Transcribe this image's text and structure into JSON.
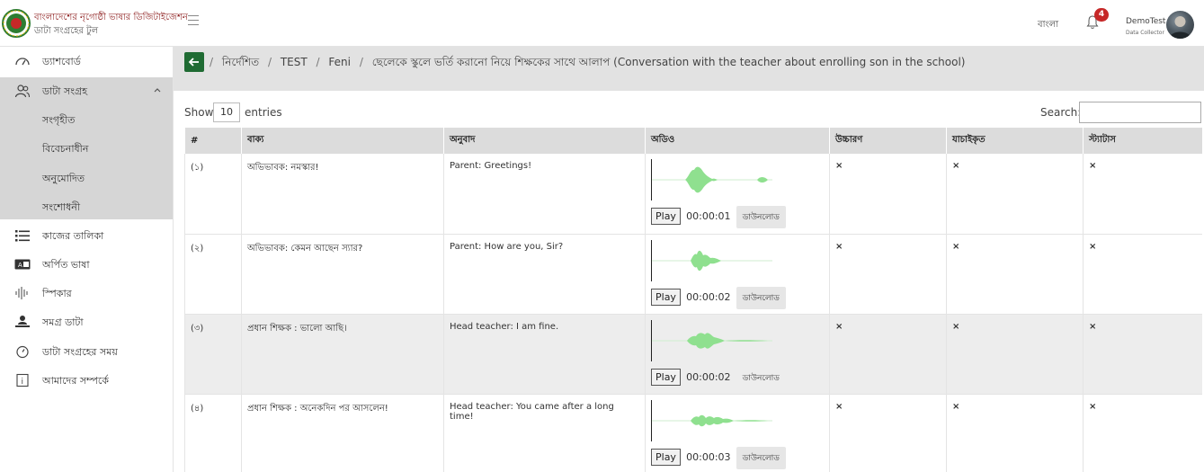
{
  "brand": {
    "title": "বাংলাদেশের নৃগোষ্ঠী ভাষার ডিজিটাইজেশন",
    "subtitle": "ডাটা সংগ্রহের টুল"
  },
  "header": {
    "language": "বাংলা",
    "notification_count": "4",
    "user_name": "DemoTest",
    "user_role": "Data Collector"
  },
  "sidebar": {
    "items": [
      {
        "label": "ড্যাশবোর্ড",
        "icon": "dashboard-gauge-icon"
      },
      {
        "label": "ডাটা সংগ্রহ",
        "icon": "users-group-icon"
      },
      {
        "label": "কাজের তালিকা",
        "icon": "list-icon"
      },
      {
        "label": "অর্পিত ভাষা",
        "icon": "language-card-icon"
      },
      {
        "label": "স্পিকার",
        "icon": "waveform-icon"
      },
      {
        "label": "সমগ্র ডাটা",
        "icon": "person-laptop-icon"
      },
      {
        "label": "ডাটা সংগ্রহের সময়",
        "icon": "timer-icon"
      },
      {
        "label": "আমাদের সম্পর্কে",
        "icon": "info-icon"
      }
    ],
    "subitems": [
      {
        "label": "সংগৃহীত"
      },
      {
        "label": "বিবেচনাধীন"
      },
      {
        "label": "অনুমোদিত"
      },
      {
        "label": "সংশোধনী"
      }
    ]
  },
  "breadcrumb": [
    "নির্দেশিত",
    "TEST",
    "Feni",
    "ছেলেকে স্কুলে ভর্তি করানো নিয়ে শিক্ষকের সাথে আলাপ (Conversation with the teacher about enrolling son in the school)"
  ],
  "table_controls": {
    "show_label": "Show",
    "page_size": "10",
    "entries_label": "entries",
    "search_label": "Search:",
    "search_value": ""
  },
  "table": {
    "columns": [
      "#",
      "বাক্য",
      "অনুবাদ",
      "অডিও",
      "উচ্চারণ",
      "যাচাইকৃত",
      "স্ট্যাটাস"
    ],
    "play_label": "Play",
    "download_label": "ডাউনলোড",
    "rows": [
      {
        "num": "(১)",
        "sentence": "অভিভাবক: নমস্কার!",
        "translation": "Parent: Greetings!",
        "time": "00:00:01",
        "pron": "×",
        "verified": "×",
        "status": "×"
      },
      {
        "num": "(২)",
        "sentence": "অভিভাবক: কেমন আছেন স্যার?",
        "translation": "Parent: How are you, Sir?",
        "time": "00:00:02",
        "pron": "×",
        "verified": "×",
        "status": "×"
      },
      {
        "num": "(৩)",
        "sentence": "প্রধান শিক্ষক : ভালো আছি।",
        "translation": "Head teacher: I am fine.",
        "time": "00:00:02",
        "pron": "×",
        "verified": "×",
        "status": "×"
      },
      {
        "num": "(৪)",
        "sentence": "প্রধান শিক্ষক : অনেকদিন পর আসলেন!",
        "translation": "Head teacher: You came after a long time!",
        "time": "00:00:03",
        "pron": "×",
        "verified": "×",
        "status": "×"
      }
    ]
  },
  "colors": {
    "accent_green": "#1f6b33",
    "waveform": "#8fe08f",
    "error_mark": "#d84b4b",
    "badge": "#c62828"
  }
}
